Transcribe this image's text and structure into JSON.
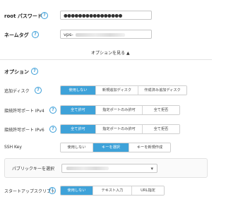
{
  "fields": {
    "root_password": {
      "label": "root パスワード",
      "value": "●●●●●●●●●●●●●●●●"
    },
    "name_tag": {
      "label": "ネームタグ",
      "value": "vps-"
    }
  },
  "options_toggle": "オプションを見る",
  "options_heading": "オプション",
  "rows": {
    "add_disk": {
      "label": "追加ディスク",
      "options": [
        "使用しない",
        "新規追加ディスク",
        "作成済み追加ディスク"
      ],
      "selected": 0
    },
    "ipv4": {
      "label": "接続許可ポート IPv4",
      "options": [
        "全て許可",
        "指定ポートのみ許可",
        "全て拒否"
      ],
      "selected": 0
    },
    "ipv6": {
      "label": "接続許可ポート IPv6",
      "options": [
        "全て許可",
        "指定ポートのみ許可",
        "全て拒否"
      ],
      "selected": 0
    },
    "ssh_key": {
      "label": "SSH Key",
      "options": [
        "使用しない",
        "キーを選択",
        "キーを新規作成"
      ],
      "selected": 1
    },
    "startup": {
      "label": "スタートアップスクリプト",
      "options": [
        "使用しない",
        "テキスト入力",
        "URL指定"
      ],
      "selected": 0
    }
  },
  "public_key": {
    "label": "パブリックキーを選択"
  },
  "icons": {
    "help": "?",
    "chevron": "⌄"
  },
  "colors": {
    "accent": "#3ea2d9"
  }
}
